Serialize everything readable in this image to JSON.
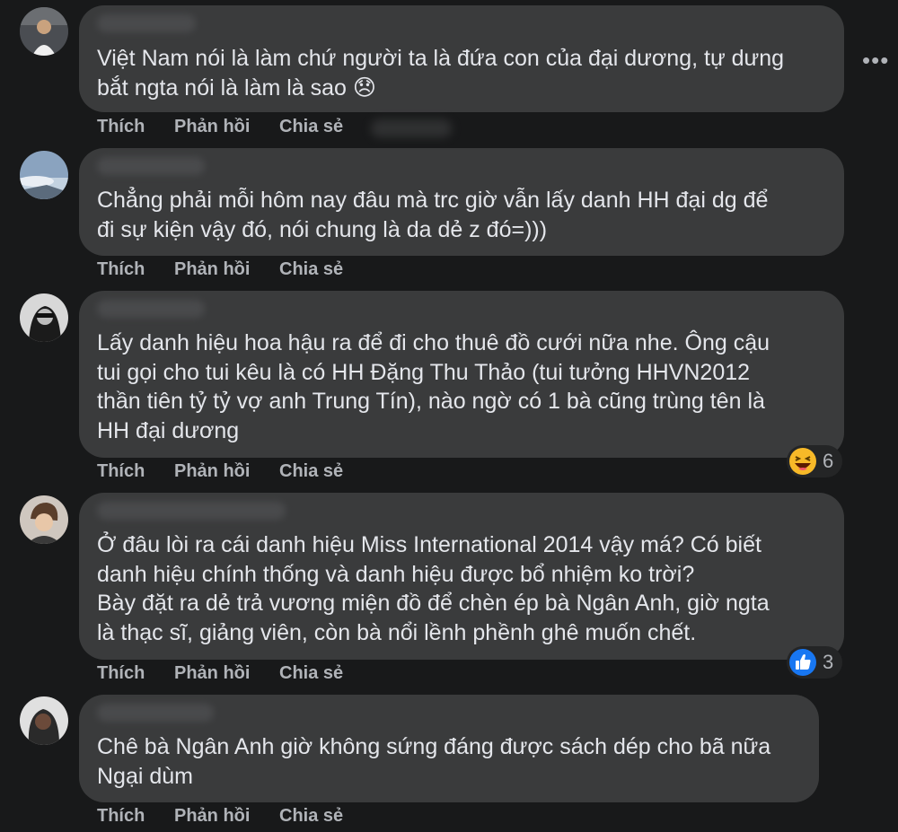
{
  "comments": [
    {
      "text": "Việt Nam nói là làm chứ người ta là đứa con của đại dương, tự dưng\nbắt ngta nói là làm là sao 😞",
      "actions": {
        "like": "Thích",
        "reply": "Phản hồi",
        "share": "Chia sẻ"
      }
    },
    {
      "text": "Chẳng phải mỗi hôm nay đâu mà trc giờ vẫn lấy danh HH đại dg để\nđi sự kiện vậy đó, nói chung là da dẻ z đó=)))",
      "actions": {
        "like": "Thích",
        "reply": "Phản hồi",
        "share": "Chia sẻ"
      }
    },
    {
      "text": "Lấy danh hiệu hoa hậu ra để đi cho thuê đồ cưới nữa nhe. Ông cậu\ntui gọi cho tui kêu là có HH Đặng Thu Thảo (tui tưởng HHVN2012\nthần tiên tỷ tỷ vợ anh Trung Tín), nào ngờ có 1 bà cũng trùng tên là\nHH đại dương",
      "actions": {
        "like": "Thích",
        "reply": "Phản hồi",
        "share": "Chia sẻ"
      },
      "reaction": {
        "icon": "haha-icon",
        "count": "6"
      }
    },
    {
      "text": "Ở đâu lòi ra cái danh hiệu Miss International 2014 vậy má? Có biết\ndanh hiệu chính thống và danh hiệu được bổ nhiệm ko trời?\nBày đặt ra dẻ trả vương miện đồ để chèn ép bà Ngân Anh, giờ ngta\nlà thạc sĩ, giảng viên, còn bà nổi lềnh phềnh ghê muốn chết.",
      "actions": {
        "like": "Thích",
        "reply": "Phản hồi",
        "share": "Chia sẻ"
      },
      "reaction": {
        "icon": "like-icon",
        "count": "3"
      }
    },
    {
      "text": "Chê bà Ngân Anh giờ không sứng đáng được sách dép cho bã nữa\nNgại dùm",
      "actions": {
        "like": "Thích",
        "reply": "Phản hồi",
        "share": "Chia sẻ"
      }
    }
  ],
  "menu": {
    "more_label": "•••"
  },
  "colors": {
    "background": "#18191a",
    "bubble": "#3a3b3c",
    "text": "#e4e6eb",
    "secondary": "#b0b3b8",
    "like_blue": "#1877f2",
    "haha_yellow": "#f7b928"
  }
}
